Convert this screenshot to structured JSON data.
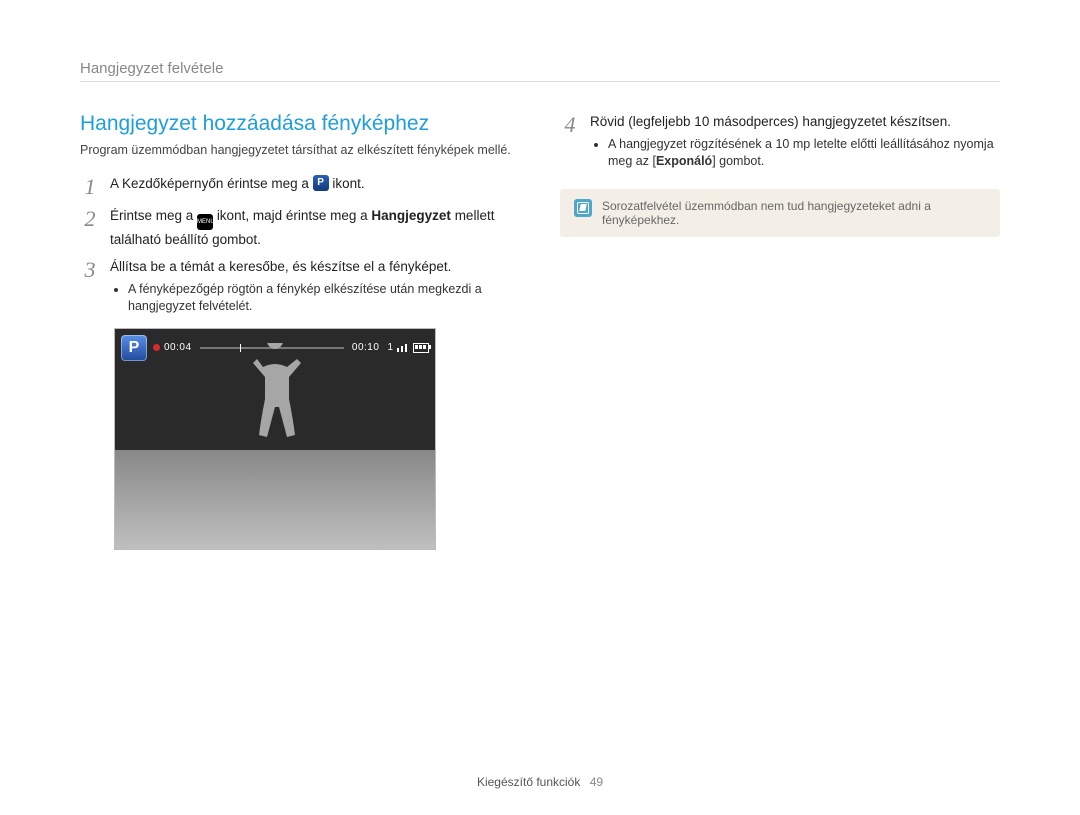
{
  "header": {
    "title": "Hangjegyzet felvétele"
  },
  "section": {
    "title": "Hangjegyzet hozzáadása fényképhez",
    "intro": "Program üzemmódban hangjegyzetet társíthat az elkészített fényképek mellé."
  },
  "steps": {
    "s1": {
      "num": "1",
      "pre": "A Kezdőképernyőn érintse meg a ",
      "post": " ikont."
    },
    "s2": {
      "num": "2",
      "pre": "Érintse meg a ",
      "mid": " ikont, majd érintse meg a ",
      "bold": "Hangjegyzet",
      "post": " mellett található beállító gombot."
    },
    "s3": {
      "num": "3",
      "text": "Állítsa be a témát a keresőbe, és készítse el a fényképet.",
      "bullet": "A fényképezőgép rögtön a fénykép elkészítése után megkezdi a hangjegyzet felvételét."
    },
    "s4": {
      "num": "4",
      "text": "Rövid (legfeljebb 10 másodperces) hangjegyzetet készítsen.",
      "bullet_pre": "A hangjegyzet rögzítésének a 10 mp letelte előtti leállításához nyomja meg az [",
      "bullet_bold": "Exponáló",
      "bullet_post": "] gombot."
    }
  },
  "preview": {
    "elapsed": "00:04",
    "total": "00:10",
    "counter": "1"
  },
  "note": {
    "text": "Sorozatfelvétel üzemmódban nem tud hangjegyzeteket adni a fényképekhez."
  },
  "footer": {
    "section": "Kiegészítő funkciók",
    "page": "49"
  }
}
